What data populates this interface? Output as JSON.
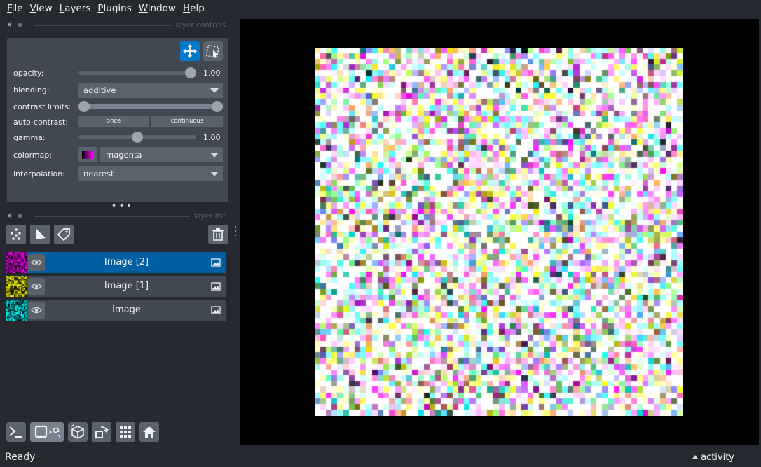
{
  "menu": [
    {
      "label_u": "F",
      "label_rest": "ile"
    },
    {
      "label_u": "V",
      "label_rest": "iew"
    },
    {
      "label_u": "L",
      "label_rest": "ayers"
    },
    {
      "label_u": "P",
      "label_rest": "lugins"
    },
    {
      "label_u": "W",
      "label_rest": "indow"
    },
    {
      "label_u": "H",
      "label_rest": "elp"
    }
  ],
  "layer_controls": {
    "title": "layer controls",
    "opacity": {
      "label": "opacity:",
      "value_text": "1.00",
      "value": 1.0
    },
    "blending": {
      "label": "blending:",
      "value": "additive"
    },
    "contrast_limits": {
      "label": "contrast limits:",
      "low": 0.0,
      "high": 1.0
    },
    "auto_contrast": {
      "label": "auto-contrast:",
      "once": "once",
      "continuous": "continuous"
    },
    "gamma": {
      "label": "gamma:",
      "value_text": "1.00",
      "value": 0.5
    },
    "colormap": {
      "label": "colormap:",
      "value": "magenta"
    },
    "interpolation": {
      "label": "interpolation:",
      "value": "nearest"
    }
  },
  "layer_list": {
    "title": "layer list",
    "layers": [
      {
        "name": "Image [2]",
        "selected": true,
        "color": "#ff00ff"
      },
      {
        "name": "Image [1]",
        "selected": false,
        "color": "#ffff00"
      },
      {
        "name": "Image",
        "selected": false,
        "color": "#00ffff"
      }
    ]
  },
  "status": {
    "text": "Ready",
    "activity": "activity"
  },
  "colors": {
    "accent": "#007acc",
    "selected_row": "#005fa3",
    "panel": "#414851",
    "background": "#262930"
  }
}
